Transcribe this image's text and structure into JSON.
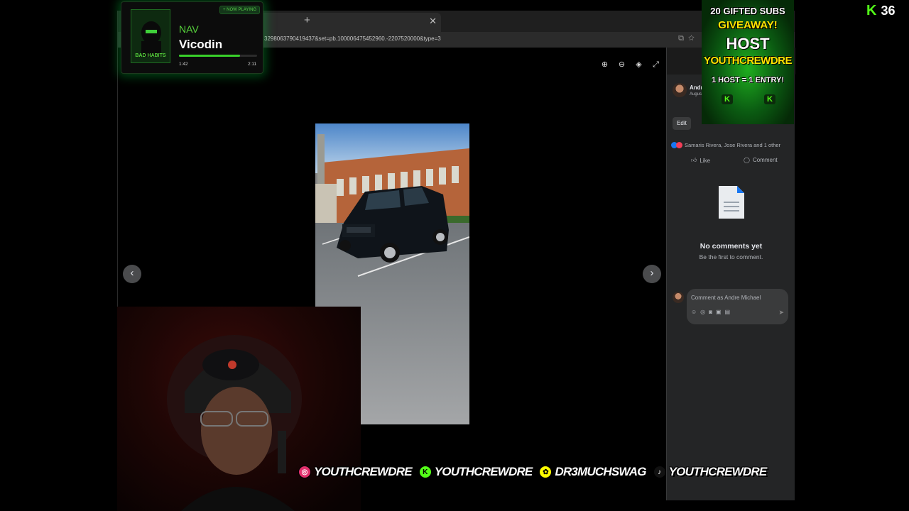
{
  "browser": {
    "url": "3298063790419437&set=pb.100006475452960.-2207520000&type=3"
  },
  "viewer": {
    "tools": [
      "zoom-in-icon",
      "zoom-out-icon",
      "tag-icon",
      "fullscreen-icon"
    ],
    "prev_arrow": "‹",
    "next_arrow": "›"
  },
  "post_panel": {
    "author_name": "Andre",
    "author_date": "August",
    "edit_label": "Edit",
    "reactions_text": "Samaris Rivera, Jose Rivera and 1 other",
    "like_label": "Like",
    "comment_label": "Comment",
    "no_comments_title": "No comments yet",
    "no_comments_sub": "Be the first to comment.",
    "composer_placeholder": "Comment as Andre Michael"
  },
  "now_playing": {
    "tag": "+ NOW PLAYING",
    "album_art_title": "BAD HABITS",
    "artist": "NAV",
    "track": "Vicodin",
    "elapsed": "1:42",
    "duration": "2:11",
    "progress": 0.78
  },
  "giveaway": {
    "line1": "20 GIFTED SUBS",
    "line2": "GIVEAWAY!",
    "line3": "HOST",
    "line4": "YOUTHCREWDRE",
    "line5": "1 HOST = 1 ENTRY!",
    "k_badge": "K"
  },
  "stream": {
    "platform_logo": "K",
    "viewer_count": "36"
  },
  "social_banner": [
    {
      "icon": "instagram-icon",
      "glyph": "◎",
      "color": "#e1306c",
      "handle": "YOUTHCREWDRE"
    },
    {
      "icon": "kick-icon",
      "glyph": "K",
      "color": "#53fc18",
      "handle": "YOUTHCREWDRE"
    },
    {
      "icon": "snapchat-icon",
      "glyph": "✿",
      "color": "#fffc00",
      "handle": "DR3MUCHSWAG"
    },
    {
      "icon": "tiktok-icon",
      "glyph": "♪",
      "color": "#111111",
      "handle": "YOUTHCREWDRE"
    }
  ],
  "colors": {
    "accent_green": "#53fc18",
    "panel_bg": "#242526",
    "giveaway_yellow": "#ffe600"
  }
}
